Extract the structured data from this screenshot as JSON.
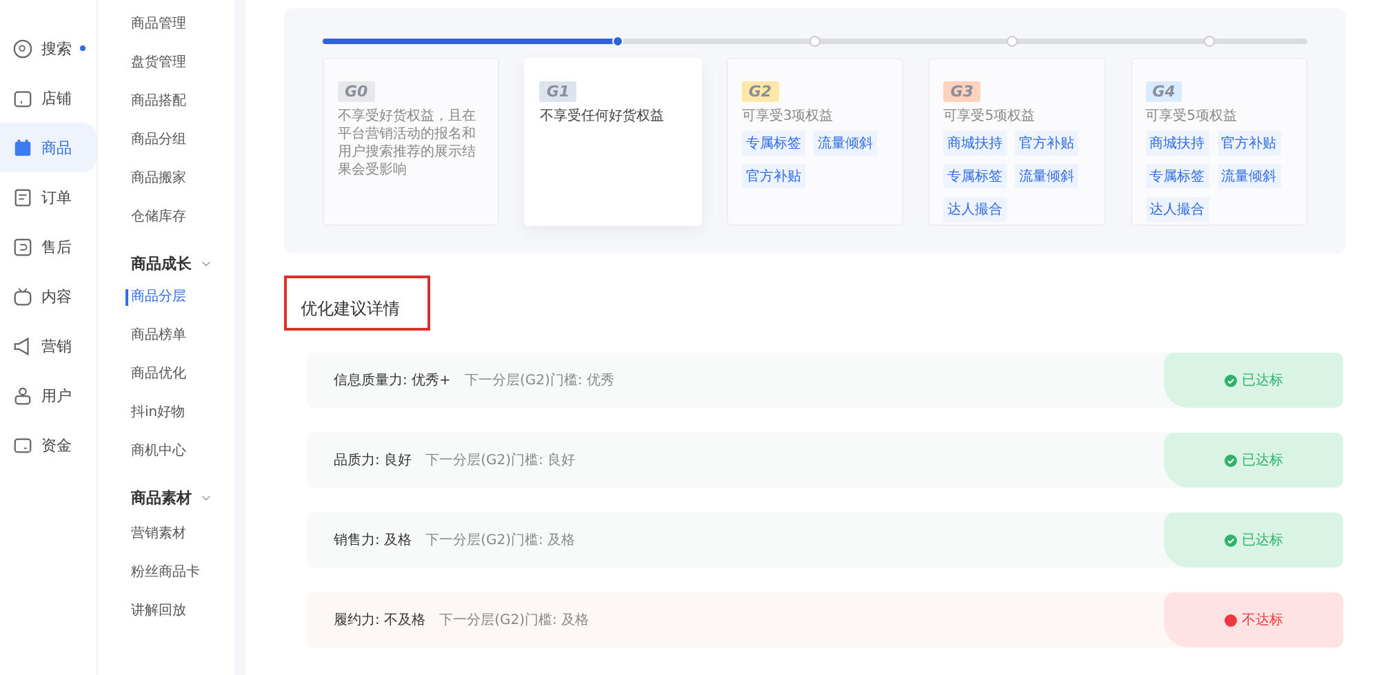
{
  "nav": [
    {
      "label": "搜索",
      "selected": false,
      "dot": true
    },
    {
      "label": "店铺",
      "selected": false,
      "dot": false
    },
    {
      "label": "商品",
      "selected": true,
      "dot": false
    },
    {
      "label": "订单",
      "selected": false,
      "dot": false
    },
    {
      "label": "售后",
      "selected": false,
      "dot": false
    },
    {
      "label": "内容",
      "selected": false,
      "dot": false
    },
    {
      "label": "营销",
      "selected": false,
      "dot": false
    },
    {
      "label": "用户",
      "selected": false,
      "dot": false
    },
    {
      "label": "资金",
      "selected": false,
      "dot": false
    }
  ],
  "submenu": [
    {
      "kind": "item",
      "label": "商品管理",
      "selected": false
    },
    {
      "kind": "item",
      "label": "盘货管理",
      "selected": false
    },
    {
      "kind": "item",
      "label": "商品搭配",
      "selected": false
    },
    {
      "kind": "item",
      "label": "商品分组",
      "selected": false
    },
    {
      "kind": "item",
      "label": "商品搬家",
      "selected": false
    },
    {
      "kind": "item",
      "label": "仓储库存",
      "selected": false
    },
    {
      "kind": "group",
      "label": "商品成长",
      "expanded": true
    },
    {
      "kind": "item",
      "label": "商品分层",
      "selected": true
    },
    {
      "kind": "item",
      "label": "商品榜单",
      "selected": false
    },
    {
      "kind": "item",
      "label": "商品优化",
      "selected": false
    },
    {
      "kind": "item",
      "label": "抖in好物",
      "selected": false
    },
    {
      "kind": "item",
      "label": "商机中心",
      "selected": false
    },
    {
      "kind": "group",
      "label": "商品素材",
      "expanded": true
    },
    {
      "kind": "item",
      "label": "营销素材",
      "selected": false
    },
    {
      "kind": "item",
      "label": "粉丝商品卡",
      "selected": false
    },
    {
      "kind": "item",
      "label": "讲解回放",
      "selected": false
    }
  ],
  "tier_progress": {
    "level": 0.3
  },
  "tiers": [
    {
      "badge": "G0",
      "color": "#e6e8ec",
      "selected": false,
      "description": "不享受好货权益，且在平台营销活动的报名和用户搜索推荐的展示结果会受影响"
    },
    {
      "badge": "G1",
      "color": "#dde4f0",
      "selected": true,
      "description": "不享受任何好货权益"
    },
    {
      "badge": "G2",
      "color": "#ffe7a8",
      "selected": false,
      "description": "可享受3项权益",
      "benefits": [
        "专属标签",
        "流量倾斜",
        "官方补贴"
      ]
    },
    {
      "badge": "G3",
      "color": "#ffd2bd",
      "selected": false,
      "description": "可享受5项权益",
      "benefits": [
        "商城扶持",
        "官方补贴",
        "专属标签",
        "流量倾斜",
        "达人撮合"
      ]
    },
    {
      "badge": "G4",
      "color": "#d8ebff",
      "selected": false,
      "description": "可享受5项权益",
      "benefits": [
        "商城扶持",
        "官方补贴",
        "专属标签",
        "流量倾斜",
        "达人撮合"
      ]
    }
  ],
  "suggestions": {
    "title": "优化建议详情",
    "rows": [
      {
        "metric": "信息质量力: 优秀+",
        "threshold": "下一分层(G2)门槛: 优秀",
        "status": "已达标",
        "kind": "passed"
      },
      {
        "metric": "品质力: 良好",
        "threshold": "下一分层(G2)门槛: 良好",
        "status": "已达标",
        "kind": "passed"
      },
      {
        "metric": "销售力: 及格",
        "threshold": "下一分层(G2)门槛: 及格",
        "status": "已达标",
        "kind": "passed"
      },
      {
        "metric": "履约力: 不及格",
        "threshold": "下一分层(G2)门槛: 及格",
        "status": "不达标",
        "kind": "failed"
      }
    ]
  }
}
